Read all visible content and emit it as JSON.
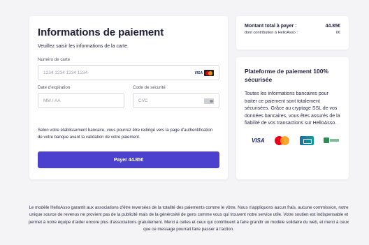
{
  "payment": {
    "title": "Informations de paiement",
    "subtitle": "Veuillez saisir les informations de la carte.",
    "card_number": {
      "label": "Numéro de carte",
      "placeholder": "1234 1234 1234 1234",
      "value": "",
      "brand_label": "VISA"
    },
    "expiry": {
      "label": "Date d'expiration",
      "placeholder": "MM / AA",
      "value": ""
    },
    "cvc": {
      "label": "Code de sécurité",
      "placeholder": "CVC",
      "value": ""
    },
    "notice": "Selon votre établissement bancaire, vous pourrez être redirigé vers la page d'authentification de votre banque avant la validation de votre paiement.",
    "pay_label": "Payer 44.85€"
  },
  "summary": {
    "total_label": "Montant total à payer :",
    "total_value": "44.85€",
    "contribution_label": "dont contribution à HelloAsso :",
    "contribution_value": "0€"
  },
  "security": {
    "title": "Plateforme de paiement 100% sécurisée",
    "text": "Toutes les informations bancaires pour traiter ce paiement sont totalement sécurisées. Grâce au cryptage SSL de vos données bancaires, vous êtes assurés de la fiabilité de vos transactions sur HelloAsso.",
    "logos": [
      "visa-logo",
      "mastercard-logo",
      "cb-logo",
      "bank-logo"
    ],
    "visa_label": "VISA"
  },
  "footer": {
    "text": "Le modèle HelloAsso garantit aux associations d'être reversées de la totalité des paiements comme le vôtre. Nous n'appliquons aucun frais, aucune commission, notre unique source de revenus ne provient pas de la publicité mais de la générosité de gens comme vous qui trouvent notre service utile. Votre soutien est indispensable et permet à notre équipe d'aider encore plus d'associations gratuitement. Merci à celles et ceux qui contribuent à faire grandir un modèle solidaire du web, et merci à ceux que ce message pourrait faire passer à l'action."
  },
  "colors": {
    "primary": "#4c40cf",
    "background": "#f4f4f6",
    "card": "#ffffff",
    "text": "#1f1f3a"
  }
}
